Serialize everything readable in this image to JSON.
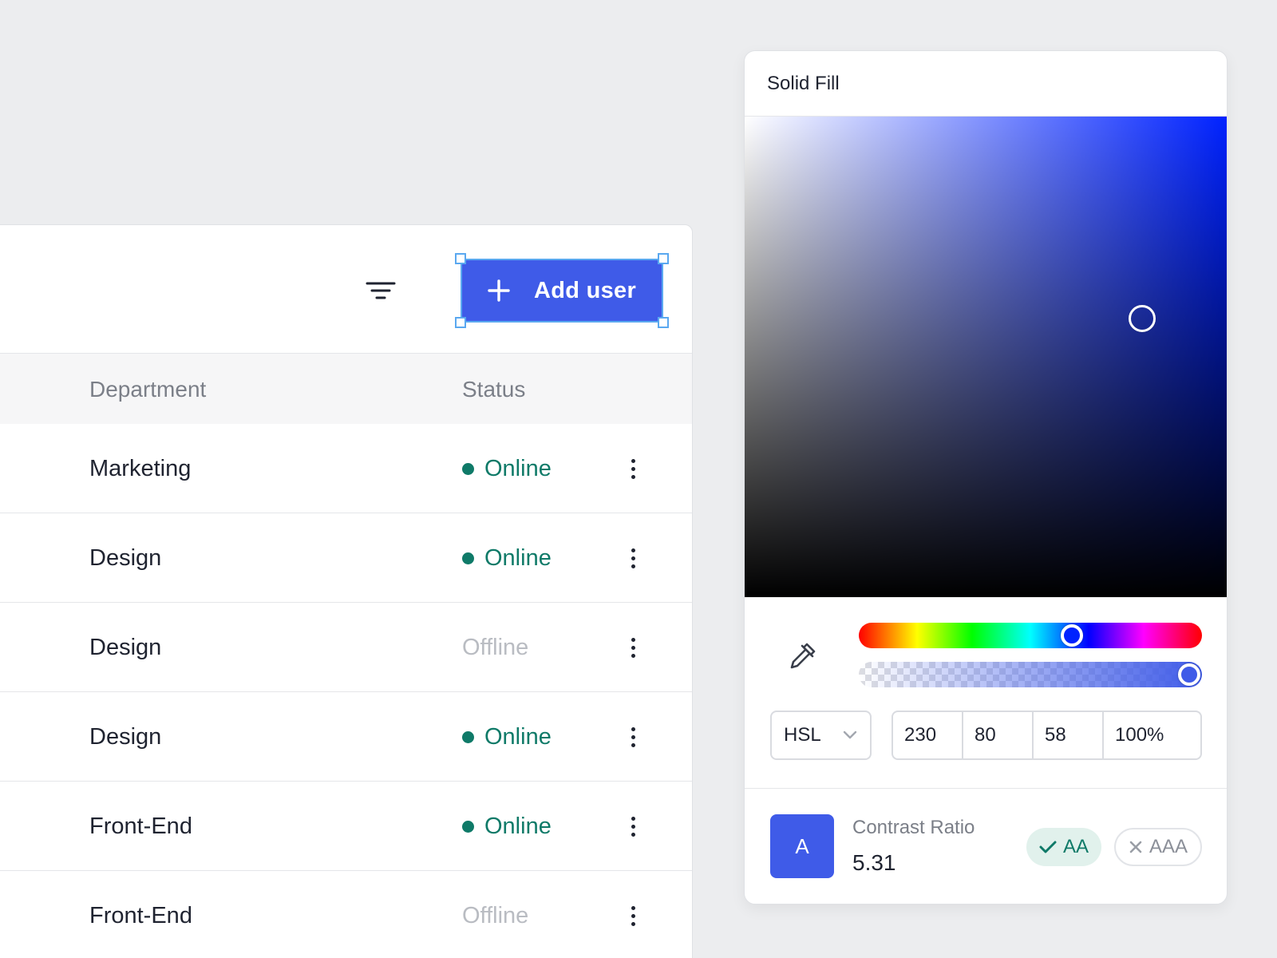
{
  "table": {
    "add_button_label": "Add user",
    "columns": {
      "department": "Department",
      "status": "Status"
    },
    "rows": [
      {
        "department": "Marketing",
        "status": "Online"
      },
      {
        "department": "Design",
        "status": "Online"
      },
      {
        "department": "Design",
        "status": "Offline"
      },
      {
        "department": "Design",
        "status": "Online"
      },
      {
        "department": "Front-End",
        "status": "Online"
      },
      {
        "department": "Front-End",
        "status": "Offline"
      }
    ],
    "colors": {
      "accent": "#3f5be8",
      "online": "#0f7a68",
      "offline": "#b9bcc2"
    }
  },
  "picker": {
    "title": "Solid Fill",
    "mode": "HSL",
    "values": {
      "h": "230",
      "s": "80",
      "l": "58",
      "alpha": "100%"
    },
    "hue_level": 0.63,
    "alpha_level": 1.0,
    "saturation_level": 0.8,
    "brightness_level": 0.58,
    "swatch_letter": "A",
    "contrast_label": "Contrast Ratio",
    "contrast_value": "5.31",
    "badges": {
      "aa": "AA",
      "aaa": "AAA"
    }
  }
}
